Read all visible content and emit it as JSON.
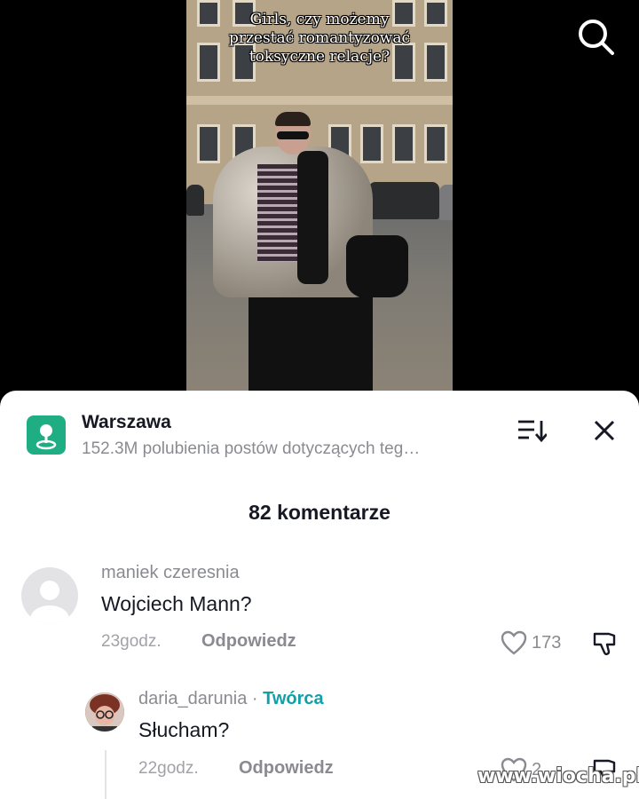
{
  "video": {
    "caption_lines": [
      "Girls, czy możemy",
      "przestać romantyzować",
      "toksyczne relacje?"
    ]
  },
  "header": {
    "search_icon": "search-icon"
  },
  "location": {
    "name": "Warszawa",
    "subtitle": "152.3M polubienia postów dotyczących teg…",
    "icon": "map-pin-icon",
    "accent": "#1fae84"
  },
  "comments": {
    "count_label": "82 komentarze",
    "items": [
      {
        "username": "maniek czeresnia",
        "text": "Wojciech Mann?",
        "time": "23godz.",
        "reply_label": "Odpowiedz",
        "likes": "173"
      },
      {
        "username": "daria_darunia",
        "separator": " · ",
        "badge": "Twórca",
        "badge_color": "#11a0a8",
        "text": "Słucham?",
        "time": "22godz.",
        "reply_label": "Odpowiedz",
        "likes": "2"
      }
    ]
  },
  "watermark": "www.wiocha.pl"
}
